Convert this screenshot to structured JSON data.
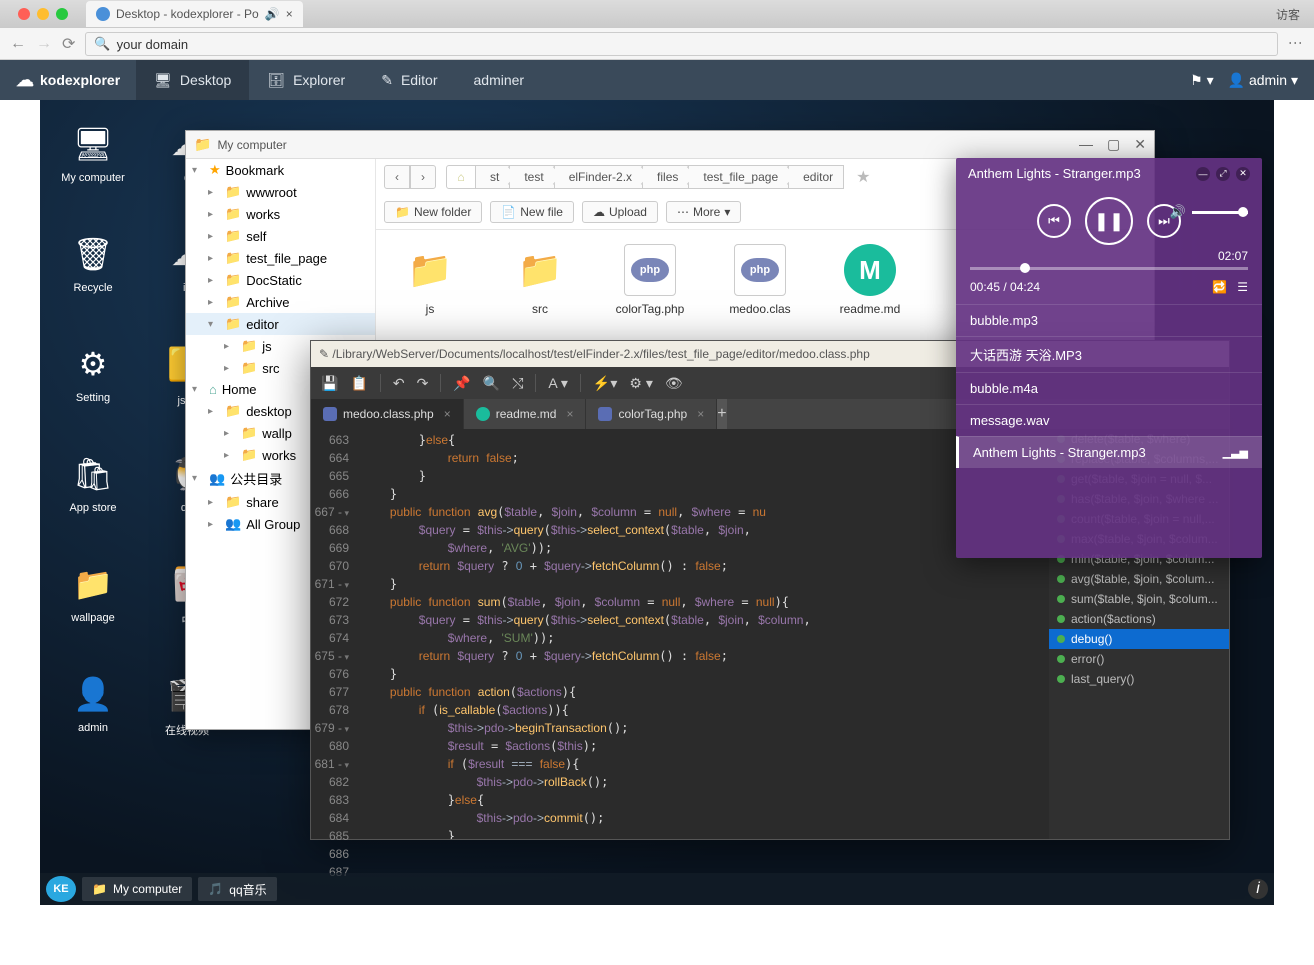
{
  "chrome": {
    "tab_title": "Desktop - kodexplorer - Po",
    "guest": "访客",
    "address": "your domain"
  },
  "appbar": {
    "brand": "kodexplorer",
    "nav": [
      "Desktop",
      "Explorer",
      "Editor",
      "adminer"
    ],
    "user": "admin"
  },
  "desktop_icons": [
    "My computer",
    "q",
    "Recycle",
    "ic",
    "Setting",
    "js在",
    "App store",
    "qq",
    "wallpage",
    "中",
    "admin",
    "在线视频"
  ],
  "filemanager": {
    "title": "My computer",
    "tree": {
      "bookmark": "Bookmark",
      "items": [
        "wwwroot",
        "works",
        "self",
        "test_file_page",
        "DocStatic",
        "Archive",
        "editor",
        "js",
        "src"
      ],
      "home": "Home",
      "home_items": [
        "desktop",
        "wallp",
        "works"
      ],
      "public": "公共目录",
      "public_items": [
        "share"
      ],
      "allgroup": "All Group"
    },
    "breadcrumbs": [
      "st",
      "test",
      "elFinder-2.x",
      "files",
      "test_file_page",
      "editor"
    ],
    "tools": {
      "newfolder": "New folder",
      "newfile": "New file",
      "upload": "Upload",
      "more": "More"
    },
    "files": [
      "js",
      "src",
      "colorTag.php",
      "medoo.clas",
      "readme.md"
    ]
  },
  "editor": {
    "path": "/Library/WebServer/Documents/localhost/test/elFinder-2.x/files/test_file_page/editor/medoo.class.php",
    "tabs": [
      "medoo.class.php",
      "readme.md",
      "colorTag.php"
    ],
    "lines": [
      663,
      664,
      665,
      666,
      667,
      668,
      669,
      670,
      671,
      672,
      673,
      674,
      675,
      676,
      677,
      678,
      679,
      680,
      681,
      682,
      683,
      684,
      685,
      686,
      687
    ],
    "outline": [
      "delete($table, $where)",
      "replace($table, $columns,...",
      "get($table, $join = null, $...",
      "has($table, $join, $where ...",
      "count($table, $join = null,...",
      "max($table, $join, $colum...",
      "min($table, $join, $colum...",
      "avg($table, $join, $colum...",
      "sum($table, $join, $colum...",
      "action($actions)",
      "debug()",
      "error()",
      "last_query()"
    ],
    "outline_active": 10
  },
  "player": {
    "title": "Anthem Lights - Stranger.mp3",
    "duration": "02:07",
    "time": "00:45 / 04:24",
    "playlist": [
      "bubble.mp3",
      "大话西游 天浴.MP3",
      "bubble.m4a",
      "message.wav",
      "Anthem Lights - Stranger.mp3"
    ],
    "playing_index": 4
  },
  "taskbar": {
    "items": [
      "My computer",
      "qq音乐"
    ]
  }
}
